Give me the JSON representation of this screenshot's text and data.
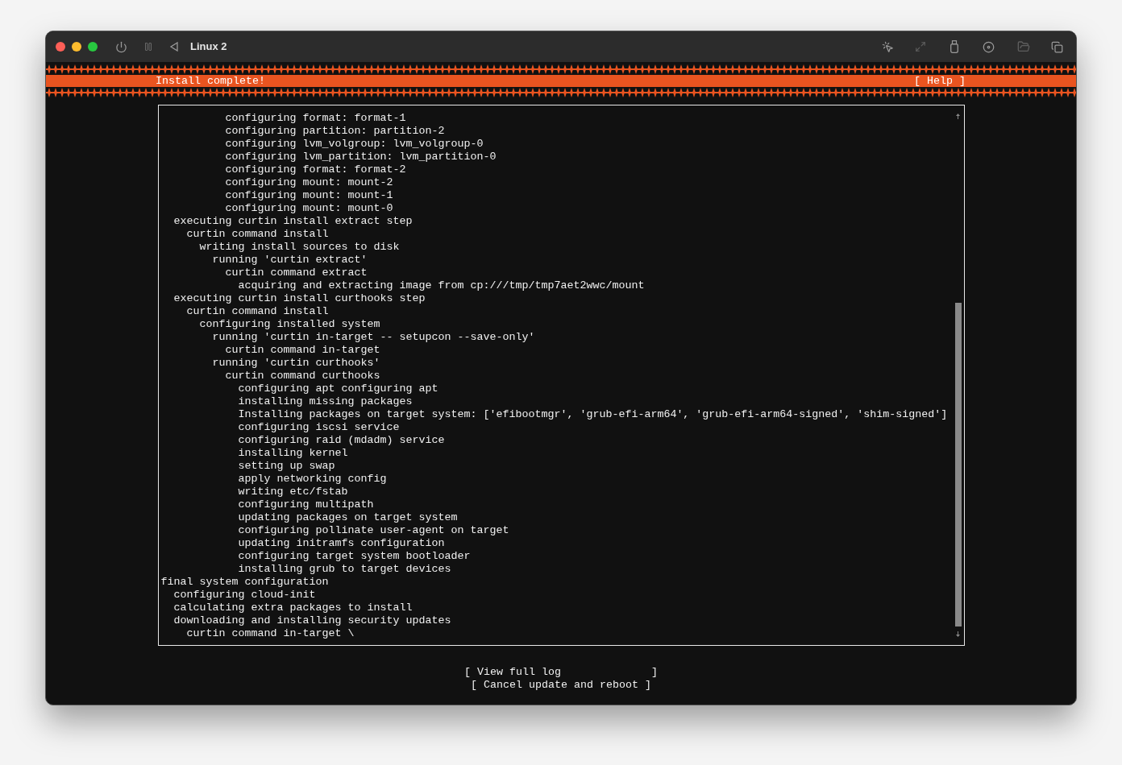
{
  "window": {
    "title": "Linux 2"
  },
  "header": {
    "title": "Install complete!",
    "help": "[ Help ]"
  },
  "log": [
    {
      "children": [
        {
          "children": [
            {
              "children": [
                {
                  "children": [
                    {
                      "children": [
                        {
                          "text": "configuring format: format-1"
                        },
                        {
                          "text": "configuring partition: partition-2"
                        },
                        {
                          "text": "configuring lvm_volgroup: lvm_volgroup-0"
                        },
                        {
                          "text": "configuring lvm_partition: lvm_partition-0"
                        },
                        {
                          "text": "configuring format: format-2"
                        },
                        {
                          "text": "configuring mount: mount-2"
                        },
                        {
                          "text": "configuring mount: mount-1"
                        },
                        {
                          "text": "configuring mount: mount-0"
                        }
                      ]
                    }
                  ]
                }
              ]
            }
          ]
        },
        {
          "text": "executing curtin install extract step",
          "children": [
            {
              "text": "curtin command install",
              "children": [
                {
                  "text": "writing install sources to disk",
                  "children": [
                    {
                      "text": "running 'curtin extract'",
                      "children": [
                        {
                          "text": "curtin command extract",
                          "children": [
                            {
                              "text": "acquiring and extracting image from cp:///tmp/tmp7aet2wwc/mount"
                            }
                          ]
                        }
                      ]
                    }
                  ]
                }
              ]
            }
          ]
        },
        {
          "text": "executing curtin install curthooks step",
          "children": [
            {
              "text": "curtin command install",
              "children": [
                {
                  "text": "configuring installed system",
                  "children": [
                    {
                      "text": "running 'curtin in-target -- setupcon --save-only'",
                      "children": [
                        {
                          "text": "curtin command in-target"
                        }
                      ]
                    },
                    {
                      "text": "running 'curtin curthooks'",
                      "children": [
                        {
                          "text": "curtin command curthooks",
                          "children": [
                            {
                              "text": "configuring apt configuring apt"
                            },
                            {
                              "text": "installing missing packages"
                            },
                            {
                              "text": "Installing packages on target system: ['efibootmgr', 'grub-efi-arm64', 'grub-efi-arm64-signed', 'shim-signed']"
                            },
                            {
                              "text": "configuring iscsi service"
                            },
                            {
                              "text": "configuring raid (mdadm) service"
                            },
                            {
                              "text": "installing kernel"
                            },
                            {
                              "text": "setting up swap"
                            },
                            {
                              "text": "apply networking config"
                            },
                            {
                              "text": "writing etc/fstab"
                            },
                            {
                              "text": "configuring multipath"
                            },
                            {
                              "text": "updating packages on target system"
                            },
                            {
                              "text": "configuring pollinate user-agent on target"
                            },
                            {
                              "text": "updating initramfs configuration"
                            },
                            {
                              "text": "configuring target system bootloader"
                            },
                            {
                              "text": "installing grub to target devices"
                            }
                          ]
                        }
                      ]
                    }
                  ]
                }
              ]
            }
          ]
        }
      ]
    },
    {
      "text": "final system configuration",
      "children": [
        {
          "text": "configuring cloud-init"
        },
        {
          "text": "calculating extra packages to install"
        },
        {
          "text": "downloading and installing security updates",
          "children": [
            {
              "text": "curtin command in-target \\"
            }
          ]
        }
      ]
    }
  ],
  "buttons": [
    {
      "label": "[ View full log              ]"
    },
    {
      "label": "[ Cancel update and reboot ]"
    }
  ]
}
